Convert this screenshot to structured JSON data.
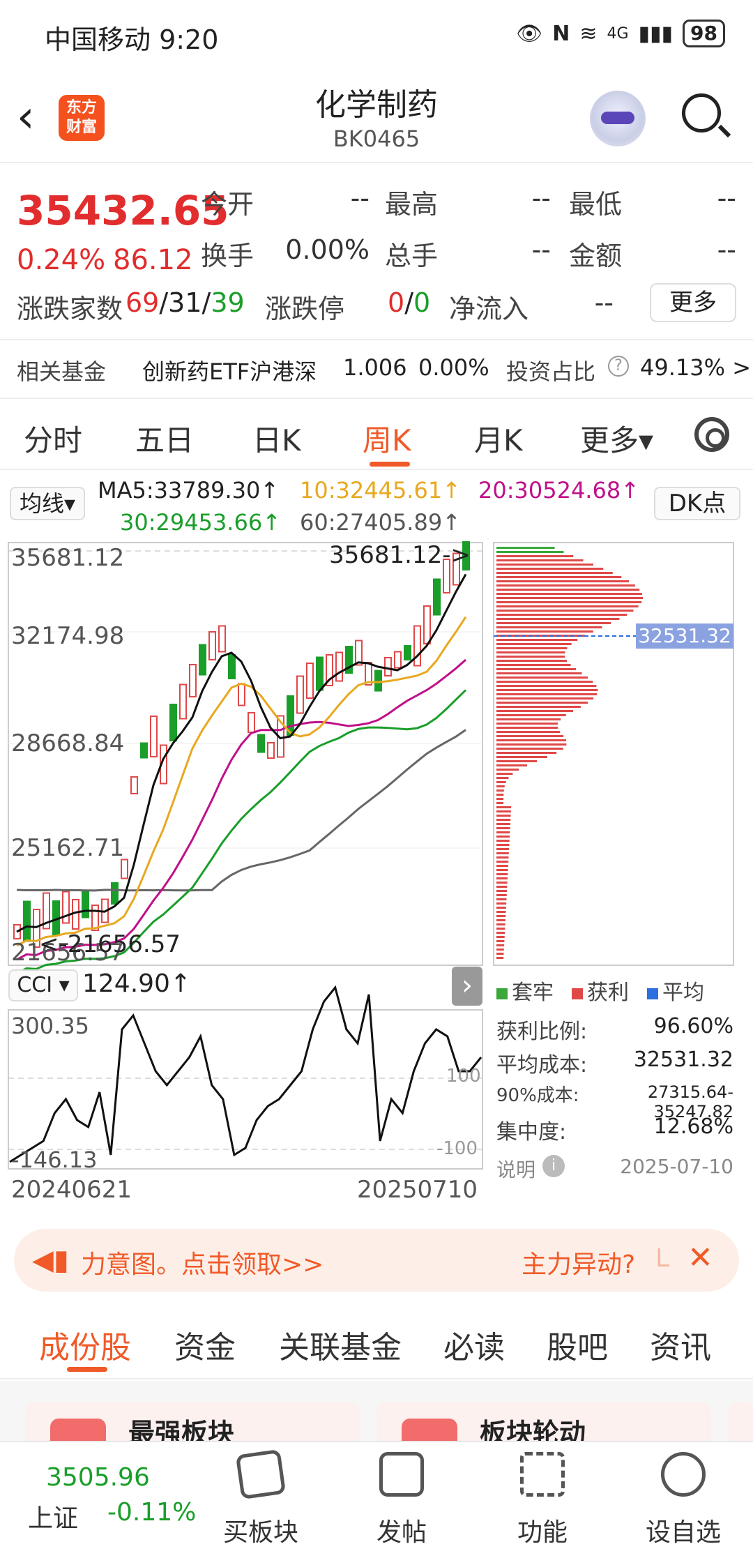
{
  "status_bar": {
    "carrier_time": "中国移动 9:20",
    "signal": "4G",
    "battery": "98"
  },
  "header": {
    "back_icon": "chevron-left-icon",
    "logo_text": "东方\n财富",
    "title": "化学制药",
    "code": "BK0465"
  },
  "quote": {
    "price": "35432.65",
    "change_pct": "0.24%",
    "change": "86.12",
    "open_label": "今开",
    "open": "--",
    "high_label": "最高",
    "high": "--",
    "low_label": "最低",
    "low": "--",
    "turnover_label": "换手",
    "turnover": "0.00%",
    "volume_label": "总手",
    "volume": "--",
    "amount_label": "金额",
    "amount": "--",
    "breadth_label": "涨跌家数",
    "up": "69",
    "flat": "31",
    "down": "39",
    "limit_label": "涨跌停",
    "limit_up": "0",
    "limit_down": "0",
    "inflow_label": "净流入",
    "inflow": "--",
    "more": "更多"
  },
  "fund": {
    "label": "相关基金",
    "name": "创新药ETF沪港深",
    "nav": "1.006",
    "pct": "0.00%",
    "ratio_label": "投资占比",
    "ratio": "49.13% >"
  },
  "period_tabs": [
    "分时",
    "五日",
    "日K",
    "周K",
    "月K",
    "更多▾"
  ],
  "active_period": "周K",
  "ma": {
    "selector": "均线▾",
    "ma5": "MA5:33789.30↑",
    "ma10": "10:32445.61↑",
    "ma20": "20:30524.68↑",
    "ma30": "30:29453.66↑",
    "ma60": "60:27405.89↑",
    "dk": "DK点"
  },
  "kline": {
    "y_labels": [
      "35681.12",
      "32174.98",
      "28668.84",
      "25162.71",
      "21656.57"
    ],
    "high_marker": "35681.12->",
    "low_marker": "<-21656.57",
    "cost_tag": "32531.32"
  },
  "cci": {
    "selector": "CCI ▾",
    "value": "124.90↑",
    "top": "300.35",
    "bottom": "-146.13",
    "ref_high": "100",
    "ref_low": "-100",
    "date_start": "20240621",
    "date_end": "20250710"
  },
  "chip": {
    "legend": [
      "套牢",
      "获利",
      "平均"
    ],
    "profit_ratio_label": "获利比例:",
    "profit_ratio": "96.60%",
    "avg_cost_label": "平均成本:",
    "avg_cost": "32531.32",
    "cost90_label": "90%成本:",
    "cost90": "27315.64-35247.82",
    "concentration_label": "集中度:",
    "concentration": "12.68%",
    "note_label": "说明",
    "date": "2025-07-10"
  },
  "banner": {
    "text": "力意图。点击领取>>",
    "right": "主力异动?",
    "sep": "L"
  },
  "sub_tabs": [
    "成份股",
    "资金",
    "关联基金",
    "必读",
    "股吧",
    "资讯"
  ],
  "active_sub_tab": "成份股",
  "cards": [
    "最强板块",
    "板块轮动"
  ],
  "bottom_nav": {
    "index_value": "3505.96",
    "index_name": "上证",
    "index_pct": "-0.11%",
    "items": [
      "买板块",
      "发帖",
      "功能",
      "设自选"
    ]
  },
  "colors": {
    "accent": "#f05a28",
    "up": "#e12d2d",
    "down": "#1a9e2a"
  }
}
